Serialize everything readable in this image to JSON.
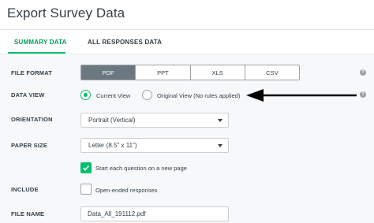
{
  "title": "Export Survey Data",
  "tabs": [
    {
      "label": "SUMMARY DATA",
      "active": true
    },
    {
      "label": "ALL RESPONSES DATA",
      "active": false
    }
  ],
  "file_format": {
    "label": "FILE FORMAT",
    "options": [
      "PDF",
      "PPT",
      "XLS",
      "CSV"
    ],
    "selected": "PDF"
  },
  "data_view": {
    "label": "DATA VIEW",
    "options": [
      {
        "label": "Current View",
        "selected": true
      },
      {
        "label": "Original View (No rules applied)",
        "selected": false
      }
    ]
  },
  "orientation": {
    "label": "ORIENTATION",
    "value": "Portrait (Vertical)"
  },
  "paper_size": {
    "label": "PAPER SIZE",
    "value": "Letter (8.5\" x 11\")"
  },
  "new_page": {
    "label": "Start each question on a new page",
    "checked": true
  },
  "include": {
    "label": "INCLUDE",
    "option_label": "Open-ended responses",
    "checked": false
  },
  "file_name": {
    "label": "FILE NAME",
    "value": "Data_All_191112.pdf"
  },
  "help_icon": "?",
  "colors": {
    "accent": "#00bf6f",
    "segment_selected": "#6b787f",
    "panel_bg": "#f7f8fa"
  }
}
